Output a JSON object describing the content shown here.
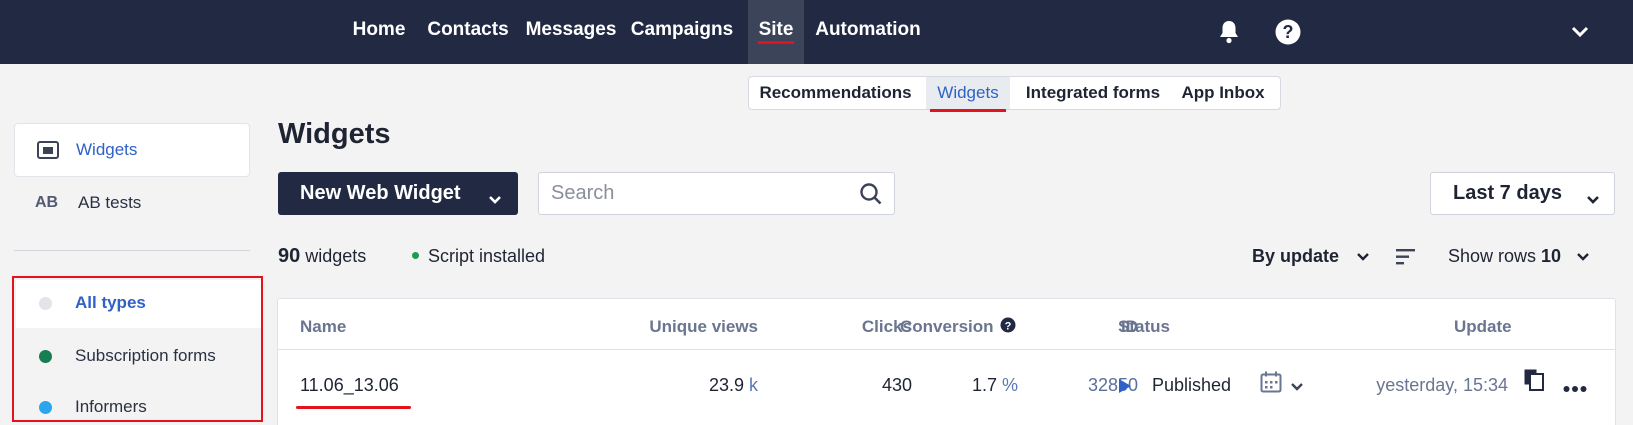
{
  "topnav": {
    "items": [
      "Home",
      "Contacts",
      "Messages",
      "Campaigns",
      "Site",
      "Automation"
    ],
    "active": "Site"
  },
  "subtabs": {
    "items": [
      "Recommendations",
      "Widgets",
      "Integrated forms",
      "App Inbox"
    ],
    "active": "Widgets"
  },
  "sidebar": {
    "widgets_label": "Widgets",
    "ab_icon_text": "AB",
    "ab_label": "AB tests",
    "types": [
      {
        "label": "All types",
        "color": "#e3e4ea"
      },
      {
        "label": "Subscription forms",
        "color": "#177d52"
      },
      {
        "label": "Informers",
        "color": "#2ba5ec"
      }
    ]
  },
  "main": {
    "title": "Widgets",
    "new_button": "New Web Widget",
    "search_placeholder": "Search",
    "period": "Last 7 days",
    "count_number": "90",
    "count_label": "widgets",
    "script_status": "Script installed",
    "sort_label": "By update",
    "rows_label": "Show rows",
    "rows_value": "10"
  },
  "table": {
    "headers": {
      "name": "Name",
      "views": "Unique views",
      "clicks": "Clicks",
      "conversion": "Conversion",
      "id": "ID",
      "status": "Status",
      "update": "Update"
    },
    "rows": [
      {
        "name": "11.06_13.06",
        "views": "23.9",
        "views_unit": "k",
        "clicks": "430",
        "conversion": "1.7",
        "conversion_unit": "%",
        "id": "32850",
        "status": "Published",
        "update": "yesterday, 15:34"
      }
    ]
  },
  "colors": {
    "topbar": "#222a43",
    "accent_red": "#e5121b",
    "link_blue": "#2f62c7",
    "status_play": "#2f62c7"
  }
}
